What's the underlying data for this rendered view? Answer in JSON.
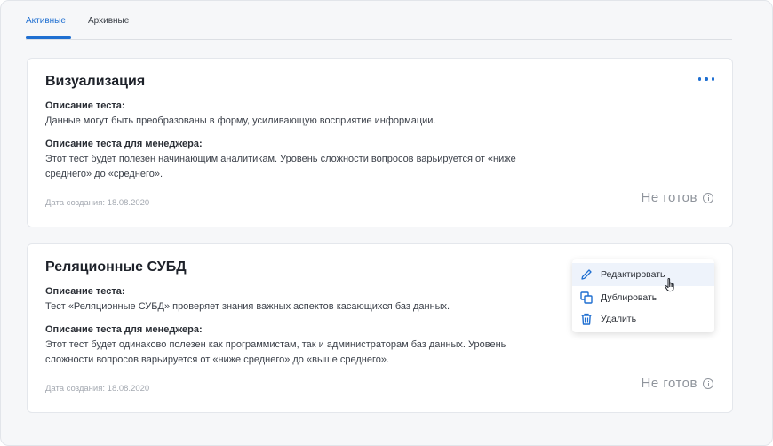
{
  "tabs": [
    {
      "label": "Активные",
      "active": true
    },
    {
      "label": "Архивные",
      "active": false
    }
  ],
  "cards": [
    {
      "title": "Визуализация",
      "desc_label": "Описание теста:",
      "desc_text": "Данные могут быть преобразованы в форму, усиливающую восприятие информации.",
      "manager_label": "Описание теста для менеджера:",
      "manager_text": "Этот тест будет полезен начинающим аналитикам. Уровень сложности вопросов варьируется от «ниже среднего» до «среднего».",
      "date": "Дата создания: 18.08.2020",
      "status": "Не готов"
    },
    {
      "title": "Реляционные СУБД",
      "desc_label": "Описание теста:",
      "desc_text": "Тест «Реляционные СУБД» проверяет знания важных аспектов касающихся баз данных.",
      "manager_label": "Описание теста для менеджера:",
      "manager_text": "Этот тест будет одинаково полезен как программистам, так и администраторам баз данных. Уровень сложности вопросов варьируется от «ниже среднего» до «выше среднего».",
      "date": "Дата создания: 18.08.2020",
      "status": "Не готов"
    }
  ],
  "menu": {
    "items": [
      {
        "label": "Редактировать",
        "icon": "pencil-icon",
        "hovered": true
      },
      {
        "label": "Дублировать",
        "icon": "copy-icon",
        "hovered": false
      },
      {
        "label": "Удалить",
        "icon": "trash-icon",
        "hovered": false
      }
    ]
  },
  "colors": {
    "accent": "#1f6fd1",
    "status": "#8f949c",
    "background": "#f6f7f9"
  }
}
